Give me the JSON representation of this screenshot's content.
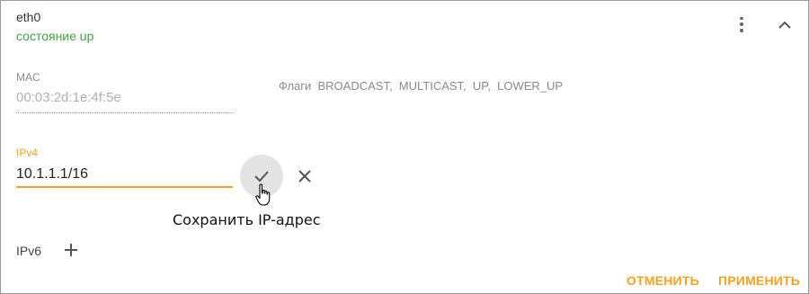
{
  "interface": {
    "name": "eth0",
    "state": "состояние up"
  },
  "icons": {
    "menu": "more-vert-icon",
    "collapse": "chevron-up-icon",
    "save": "check-icon",
    "cancel": "close-icon",
    "add": "plus-icon",
    "cursor": "hand-pointer-icon"
  },
  "mac": {
    "label": "MAC",
    "value": "00:03:2d:1e:4f:5e"
  },
  "flags": {
    "text": "Флаги  BROADCAST,  MULTICAST,  UP,  LOWER_UP"
  },
  "ipv4": {
    "label": "IPv4",
    "value": "10.1.1.1/16"
  },
  "tooltip": {
    "text": "Сохранить IP-адрес"
  },
  "ipv6": {
    "label": "IPv6"
  },
  "actions": {
    "cancel_label": "ОТМЕНИТЬ",
    "apply_label": "ПРИМЕНИТЬ"
  },
  "colors": {
    "accent": "#f5a21d",
    "state_ok": "#43a047"
  }
}
